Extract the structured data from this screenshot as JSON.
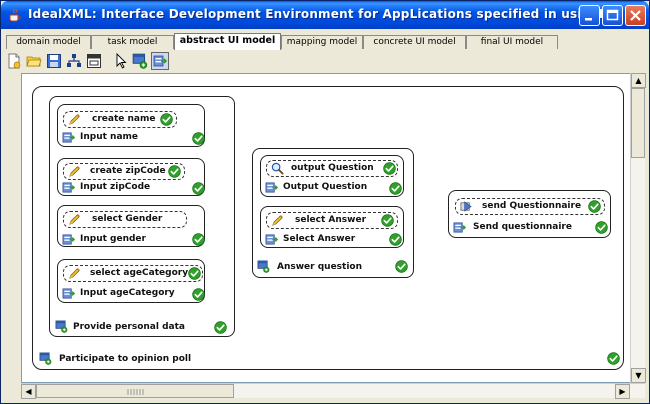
{
  "window": {
    "title": "IdealXML: Interface Development Environment for AppLications specified in usiXML"
  },
  "tabs": [
    {
      "label": "domain model",
      "active": false
    },
    {
      "label": "task model",
      "active": false
    },
    {
      "label": "abstract UI model",
      "active": true
    },
    {
      "label": "mapping model",
      "active": false
    },
    {
      "label": "concrete UI model",
      "active": false
    },
    {
      "label": "final UI model",
      "active": false
    }
  ],
  "toolbar": {
    "icons": [
      "new-file-icon",
      "open-folder-icon",
      "save-icon",
      "tree-icon",
      "export-pdf-icon",
      "pointer-icon",
      "add-container-icon",
      "add-component-icon"
    ]
  },
  "diagram": {
    "root": {
      "label": "Participate to opinion poll"
    },
    "groups": [
      {
        "label": "Provide personal data",
        "items": [
          {
            "facet": "create name",
            "label": "Input name"
          },
          {
            "facet": "create zipCode",
            "label": "Input zipCode"
          },
          {
            "facet": "select Gender",
            "label": "Input gender"
          },
          {
            "facet": "select ageCategory",
            "label": "Input ageCategory"
          }
        ]
      },
      {
        "label": "Answer question",
        "items": [
          {
            "facet": "output Question",
            "label": "Output Question"
          },
          {
            "facet": "select Answer",
            "label": "Select Answer"
          }
        ]
      },
      {
        "label": "",
        "items": [
          {
            "facet": "send Questionnaire",
            "label": "Send questionnaire"
          }
        ]
      }
    ]
  },
  "colors": {
    "titlebar": "#0055e5",
    "check": "#2fa12a",
    "canvas": "#ffffff"
  }
}
